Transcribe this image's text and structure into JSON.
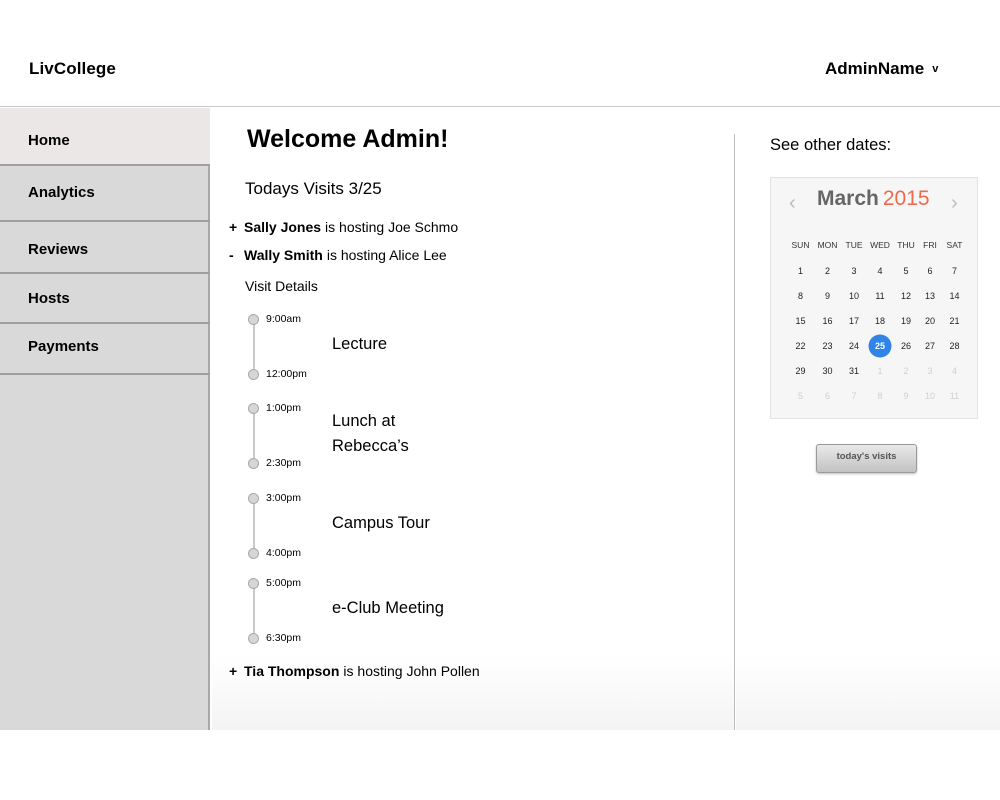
{
  "header": {
    "brand": "LivCollege",
    "user_name": "AdminName",
    "user_caret": "v"
  },
  "sidebar": {
    "items": [
      {
        "label": "Home",
        "active": true
      },
      {
        "label": "Analytics"
      },
      {
        "label": "Reviews"
      },
      {
        "label": "Hosts"
      },
      {
        "label": "Payments"
      }
    ]
  },
  "main": {
    "welcome": "Welcome Admin!",
    "visits_heading": "Todays Visits 3/25",
    "visits": [
      {
        "toggle": "+",
        "host": "Sally Jones",
        "text": "is hosting Joe Schmo"
      },
      {
        "toggle": "-",
        "host": "Wally Smith",
        "text": "is hosting Alice Lee"
      },
      {
        "toggle": "+",
        "host": "Tia Thompson",
        "text": "is hosting John Pollen"
      }
    ],
    "visit_details_label": "Visit Details",
    "schedule": [
      {
        "start": "9:00am",
        "end": "12:00pm",
        "event": "Lecture"
      },
      {
        "start": "1:00pm",
        "end": "2:30pm",
        "event_line1": "Lunch at",
        "event_line2": "Rebecca’s"
      },
      {
        "start": "3:00pm",
        "end": "4:00pm",
        "event": "Campus Tour"
      },
      {
        "start": "5:00pm",
        "end": "6:30pm",
        "event": "e-Club Meeting"
      }
    ]
  },
  "right_panel": {
    "see_other_dates": "See other dates:",
    "calendar": {
      "prev": "‹",
      "next": "›",
      "month": "March",
      "year": "2015",
      "days_of_week": [
        "SUN",
        "MON",
        "TUE",
        "WED",
        "THU",
        "FRI",
        "SAT"
      ],
      "weeks": [
        [
          "1",
          "2",
          "3",
          "4",
          "5",
          "6",
          "7"
        ],
        [
          "8",
          "9",
          "10",
          "11",
          "12",
          "13",
          "14"
        ],
        [
          "15",
          "16",
          "17",
          "18",
          "19",
          "20",
          "21"
        ],
        [
          "22",
          "23",
          "24",
          "25",
          "26",
          "27",
          "28"
        ],
        [
          "29",
          "30",
          "31",
          "1",
          "2",
          "3",
          "4"
        ],
        [
          "5",
          "6",
          "7",
          "8",
          "9",
          "10",
          "11"
        ]
      ],
      "selected_day": "25",
      "selected_color": "#2f84e6",
      "year_color": "#ee6a4c"
    },
    "today_button": "today's visits"
  }
}
